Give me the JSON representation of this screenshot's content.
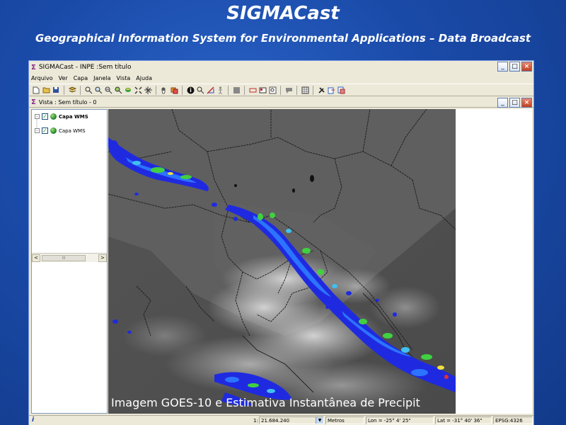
{
  "slide": {
    "title": "SIGMACast",
    "subtitle": "Geographical Information System for Environmental Applications – Data Broadcast"
  },
  "window": {
    "title_symbol": "Σ",
    "title": "SIGMACast - INPE  :Sem título",
    "buttons": {
      "minimize": "_",
      "maximize": "□",
      "close": "×"
    }
  },
  "menu": [
    "Arquivo",
    "Ver",
    "Capa",
    "Janela",
    "Vista",
    "Ajuda"
  ],
  "toolbar": {
    "icons": [
      "new-file-icon",
      "open-folder-icon",
      "save-icon",
      "layers-icon",
      "zoom-extent-icon",
      "zoom-in-icon",
      "zoom-out-icon",
      "zoom-layer-icon",
      "select-icon",
      "full-extent-icon",
      "move-icon",
      "pan-hand-icon",
      "layer-add-icon",
      "info-icon",
      "locate-icon",
      "measure-icon",
      "figure-icon",
      "gray-box-icon",
      "rectangle-icon",
      "table-icon",
      "zoom-box-icon",
      "comment-icon",
      "grid-icon",
      "tools-icon",
      "export-icon",
      "print-icon"
    ]
  },
  "view": {
    "title_symbol": "Σ",
    "title": "Vista : Sem título - 0",
    "buttons": {
      "minimize": "_",
      "maximize": "□",
      "close": "×"
    }
  },
  "layers": [
    {
      "name": "Capa WMS",
      "checked": true,
      "bold": true
    },
    {
      "name": "Capa WMS",
      "checked": true,
      "bold": false
    }
  ],
  "scroll": {
    "left": "<",
    "grip": "III",
    "right": ">"
  },
  "map": {
    "caption": "Imagem GOES-10 e Estimativa Instantânea de Precipit"
  },
  "status": {
    "info_icon": "i",
    "scale_prefix": "1:",
    "scale_value": "21.684.240",
    "units": "Metros",
    "lon": "Lon = -25° 4' 25\"",
    "lat": "Lat = -31° 40' 36\"",
    "epsg": "EPSG:4326"
  },
  "colors": {
    "slide_background": "#1a4aa8",
    "window_chrome": "#ece9d8",
    "satellite_gray": "#5b5b5b",
    "precipitation_blue": "#1f2ae0",
    "precipitation_green": "#40d040"
  }
}
